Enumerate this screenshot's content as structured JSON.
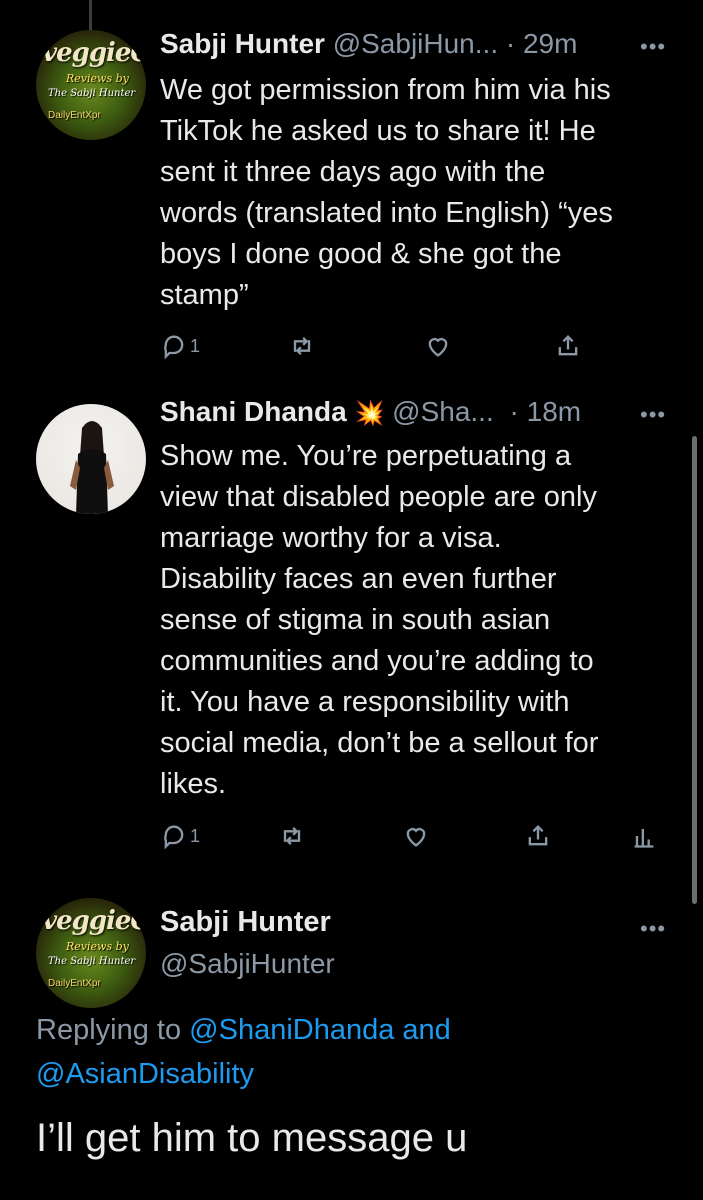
{
  "tweets": [
    {
      "name": "Sabji Hunter",
      "handle": "@SabjiHun...",
      "time": "· 29m",
      "text": "We got permission from him via his\nTikTok he asked us to share it! He\nsent it three days ago with the\nwords (translated into English) “yes\nboys I done good & she got the\nstamp”",
      "reply_count": "1",
      "avatar": {
        "brand": "veggieG",
        "line1": "Reviews by",
        "line2": "The Sabji Hunter",
        "line3": "DailyEntXpr"
      }
    },
    {
      "name": "Shani Dhanda",
      "emoji": "💥",
      "handle": "@Sha...",
      "time": "· 18m",
      "text": "Show me. You’re perpetuating a\nview that disabled people are only\nmarriage worthy for a visa.\nDisability faces an even further\nsense of stigma in south asian\ncommunities and you’re adding to\nit. You have a responsibility with\nsocial media, don’t be a sellout for\nlikes.",
      "reply_count": "1"
    }
  ],
  "main_tweet": {
    "name": "Sabji Hunter",
    "handle": "@SabjiHunter",
    "replying_prefix": "Replying to",
    "mention1": "@ShaniDhanda",
    "and_word": "and",
    "mention2": "@AsianDisability",
    "text": "I’ll get him to message u",
    "avatar": {
      "brand": "veggieG",
      "line1": "Reviews by",
      "line2": "The Sabji Hunter",
      "line3": "DailyEntXpr"
    }
  },
  "icons": [
    "reply-icon",
    "retweet-icon",
    "like-icon",
    "share-icon",
    "analytics-icon",
    "more-icon"
  ],
  "colors": {
    "background": "#000000",
    "text": "#e7e9ea",
    "muted": "#8b98a5",
    "link": "#1d9bf0"
  }
}
